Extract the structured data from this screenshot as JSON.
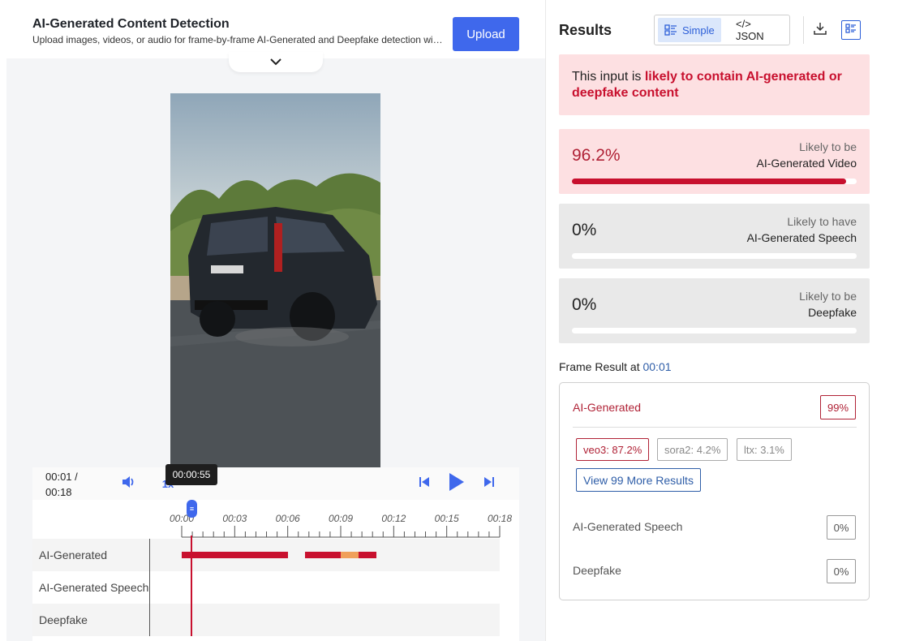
{
  "header": {
    "title": "AI-Generated Content Detection",
    "subtitle": "Upload images, videos, or audio for frame-by-frame AI-Generated and Deepfake detection with...",
    "upload_label": "Upload"
  },
  "player": {
    "time_current": "00:01 /",
    "time_total": "00:18",
    "speed_label": "1x",
    "hover_tooltip": "00:00:55",
    "ticks": [
      "00:00",
      "00:03",
      "00:06",
      "00:09",
      "00:12",
      "00:15",
      "00:18"
    ],
    "playhead_time_s": 1,
    "tracks": [
      {
        "label": "AI-Generated",
        "segments": [
          {
            "start_s": 0,
            "end_s": 6.0,
            "color": "#c8102e"
          },
          {
            "start_s": 7.0,
            "end_s": 9.0,
            "color": "#c8102e"
          },
          {
            "start_s": 9.0,
            "end_s": 10.0,
            "color": "#f0a05a"
          },
          {
            "start_s": 10.0,
            "end_s": 11.0,
            "color": "#c8102e"
          }
        ]
      },
      {
        "label": "AI-Generated Speech",
        "segments": []
      },
      {
        "label": "Deepfake",
        "segments": []
      }
    ]
  },
  "results": {
    "title": "Results",
    "toggle_simple": "Simple",
    "toggle_json": "</> JSON",
    "verdict_prefix": "This input is ",
    "verdict_highlight": "likely to contain AI-generated or deepfake content",
    "scores": [
      {
        "value": "96.2%",
        "fraction": 0.962,
        "cap1": "Likely to be",
        "cap2": "AI-Generated Video",
        "bg": "#fde0e2",
        "value_color": "#b02236"
      },
      {
        "value": "0%",
        "fraction": 0,
        "cap1": "Likely to have",
        "cap2": "AI-Generated Speech",
        "bg": "#e9e9e9",
        "value_color": "#222222"
      },
      {
        "value": "0%",
        "fraction": 0,
        "cap1": "Likely to be",
        "cap2": "Deepfake",
        "bg": "#e9e9e9",
        "value_color": "#222222"
      }
    ],
    "frame_heading": "Frame Result at ",
    "frame_time": "00:01",
    "frame": {
      "ai_label": "AI-Generated",
      "ai_badge": "99%",
      "chips": [
        "veo3: 87.2%",
        "sora2: 4.2%",
        "ltx: 3.1%"
      ],
      "more_label": "View 99 More Results",
      "speech_label": "AI-Generated Speech",
      "speech_badge": "0%",
      "deepfake_label": "Deepfake",
      "deepfake_badge": "0%"
    }
  },
  "colors": {
    "accent": "#3f68ec",
    "danger": "#c8102e",
    "link": "#2f5ea8"
  }
}
